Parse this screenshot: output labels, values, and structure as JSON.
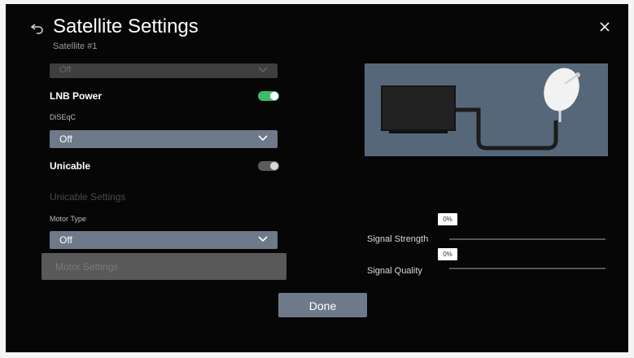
{
  "header": {
    "title": "Satellite Settings",
    "subtitle": "Satellite #1"
  },
  "settings": {
    "top_dropdown_value": "Off",
    "lnb_power": {
      "label": "LNB Power",
      "on": true
    },
    "diseqc": {
      "label": "DiSEqC",
      "value": "Off"
    },
    "unicable": {
      "label": "Unicable",
      "on": false
    },
    "unicable_settings_label": "Unicable Settings",
    "motor_type": {
      "label": "Motor Type",
      "value": "Off"
    },
    "motor_settings_label": "Motor Settings"
  },
  "signal": {
    "strength_label": "Signal Strength",
    "strength_value": "0%",
    "quality_label": "Signal Quality",
    "quality_value": "0%"
  },
  "done_label": "Done",
  "colors": {
    "accent": "#6e7a89",
    "toggle_on": "#3fba6b",
    "illustration_bg": "#56677a"
  }
}
